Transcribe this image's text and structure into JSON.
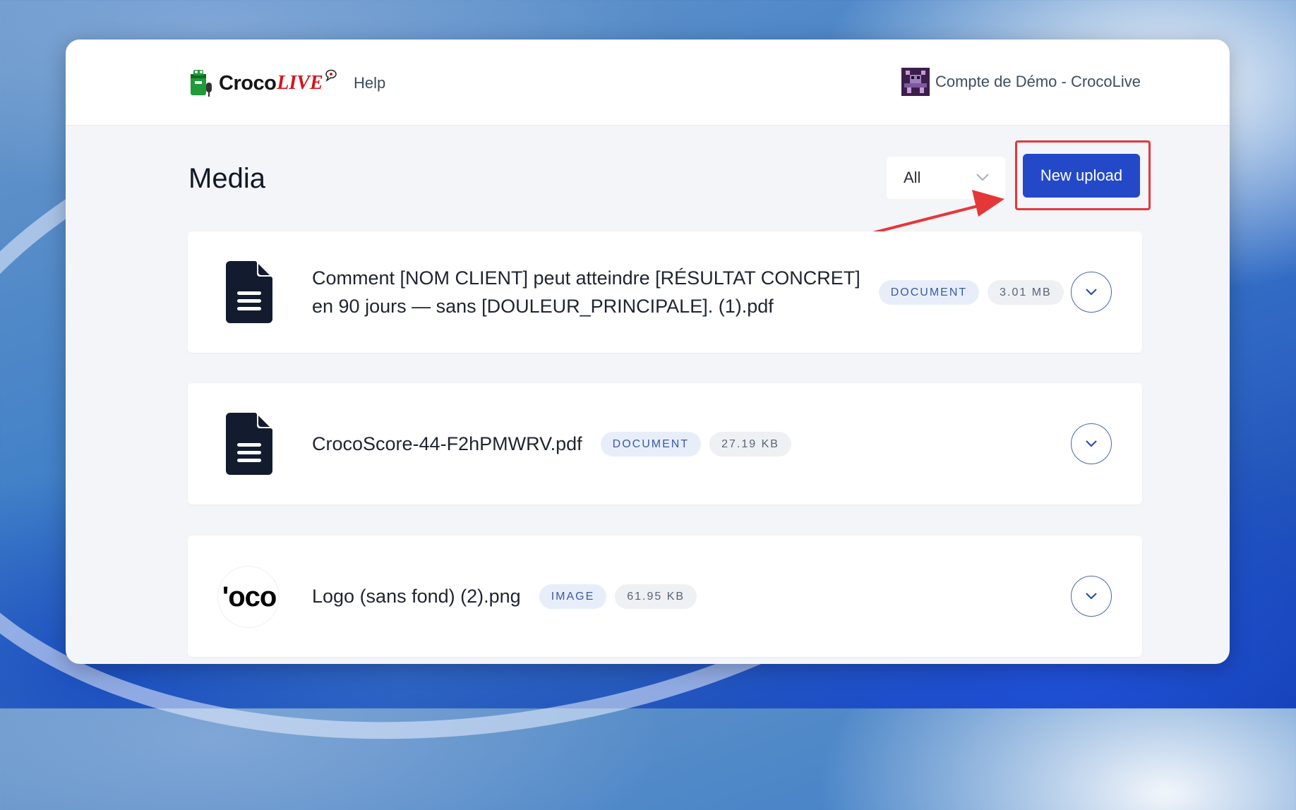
{
  "header": {
    "logo_text_main": "Croco",
    "logo_text_accent": "LIVE",
    "help_label": "Help",
    "account_name": "Compte de Démo - CrocoLive"
  },
  "media": {
    "title": "Media",
    "filter_value": "All",
    "new_upload_label": "New upload"
  },
  "items": [
    {
      "icon": "document-icon",
      "name_line1": "Comment [NOM CLIENT] peut atteindre [RÉSULTAT CONCRET]",
      "name_line2": "en 90 jours — sans [DOULEUR_PRINCIPALE]. (1).pdf",
      "type": "DOCUMENT",
      "size": "3.01 MB"
    },
    {
      "icon": "document-icon",
      "name": "CrocoScore-44-F2hPMWRV.pdf",
      "type": "DOCUMENT",
      "size": "27.19 KB"
    },
    {
      "icon": "image-thumbnail",
      "thumb_text": "'oco",
      "name": "Logo (sans fond) (2).png",
      "type": "IMAGE",
      "size": "61.95 KB"
    }
  ],
  "colors": {
    "primary": "#2449c8",
    "highlight": "#e5373a",
    "brand_red": "#d4141c"
  }
}
